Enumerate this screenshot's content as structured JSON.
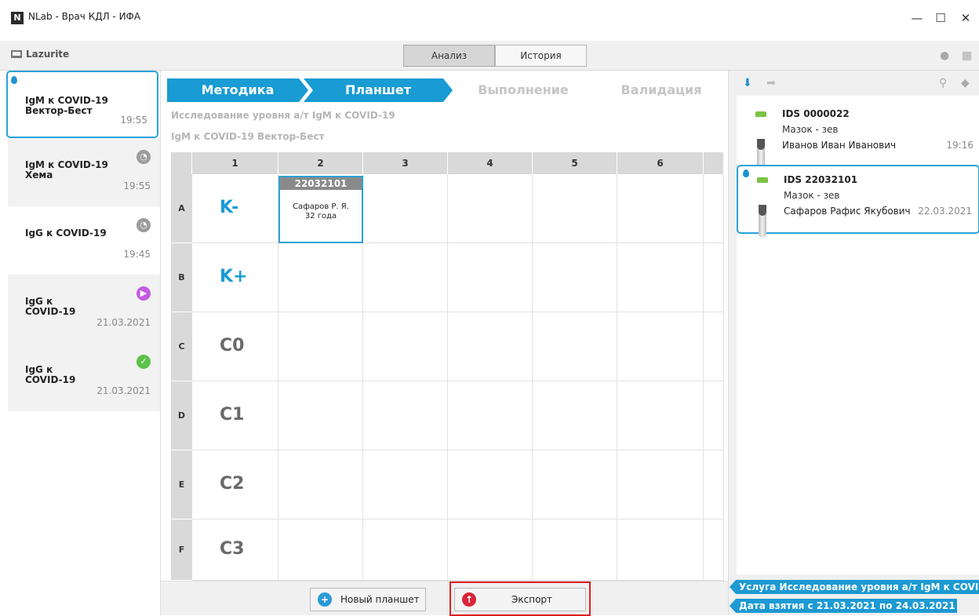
{
  "window": {
    "title": "NLab - Врач КДЛ - ИФА",
    "app_icon": "N",
    "minimize": "—",
    "maximize": "☐",
    "close": "✕"
  },
  "toolbar": {
    "brand": "Lazurite",
    "tab_analysis": "Анализ",
    "tab_history": "История",
    "user_icon": "person-icon",
    "grid_icon": "apps-icon"
  },
  "sidebar": {
    "items": [
      {
        "name": "IgM к COVID-19 Вектор-Бест",
        "time": "19:55",
        "status": "selected"
      },
      {
        "name": "IgM к COVID-19 Хема",
        "time": "19:55",
        "status": "clock"
      },
      {
        "name": "IgG к COVID-19",
        "time": "19:45",
        "status": "clock"
      },
      {
        "name": "IgG к COVID-19",
        "time": "21.03.2021",
        "status": "play"
      },
      {
        "name": "IgG к COVID-19",
        "time": "21.03.2021",
        "status": "done"
      }
    ]
  },
  "steps": [
    "Методика",
    "Планшет",
    "Выполнение",
    "Валидация"
  ],
  "main": {
    "subtitle1": "Исследование уровня а/т IgM к COVID-19",
    "subtitle2": "IgM к COVID-19 Вектор-Бест"
  },
  "plate": {
    "columns": [
      "1",
      "2",
      "3",
      "4",
      "5",
      "6"
    ],
    "rows": [
      "A",
      "B",
      "C",
      "D",
      "E",
      "F"
    ],
    "controls": [
      "K-",
      "K+",
      "C0",
      "C1",
      "C2",
      "C3"
    ],
    "sample": {
      "id": "22032101",
      "patient": "Сафаров Р. Я.",
      "age": "32 года"
    }
  },
  "bottom": {
    "new_plate": "Новый планшет",
    "export": "Экспорт"
  },
  "right": {
    "samples": [
      {
        "id": "IDS 0000022",
        "material": "Мазок - зев",
        "patient": "Иванов Иван Иванович",
        "time": "19:16"
      },
      {
        "id": "IDS 22032101",
        "material": "Мазок - зев",
        "patient": "Сафаров Рафис Якубович",
        "time": "22.03.2021"
      }
    ],
    "filters": [
      "Услуга Исследование уровня а/т IgM к COVID-",
      "Дата взятия с 21.03.2021 по 24.03.2021 ×"
    ]
  },
  "colors": {
    "accent": "#199bd3",
    "highlight_red": "#e01e1e",
    "success": "#5cc24a",
    "play": "#c45be0"
  }
}
